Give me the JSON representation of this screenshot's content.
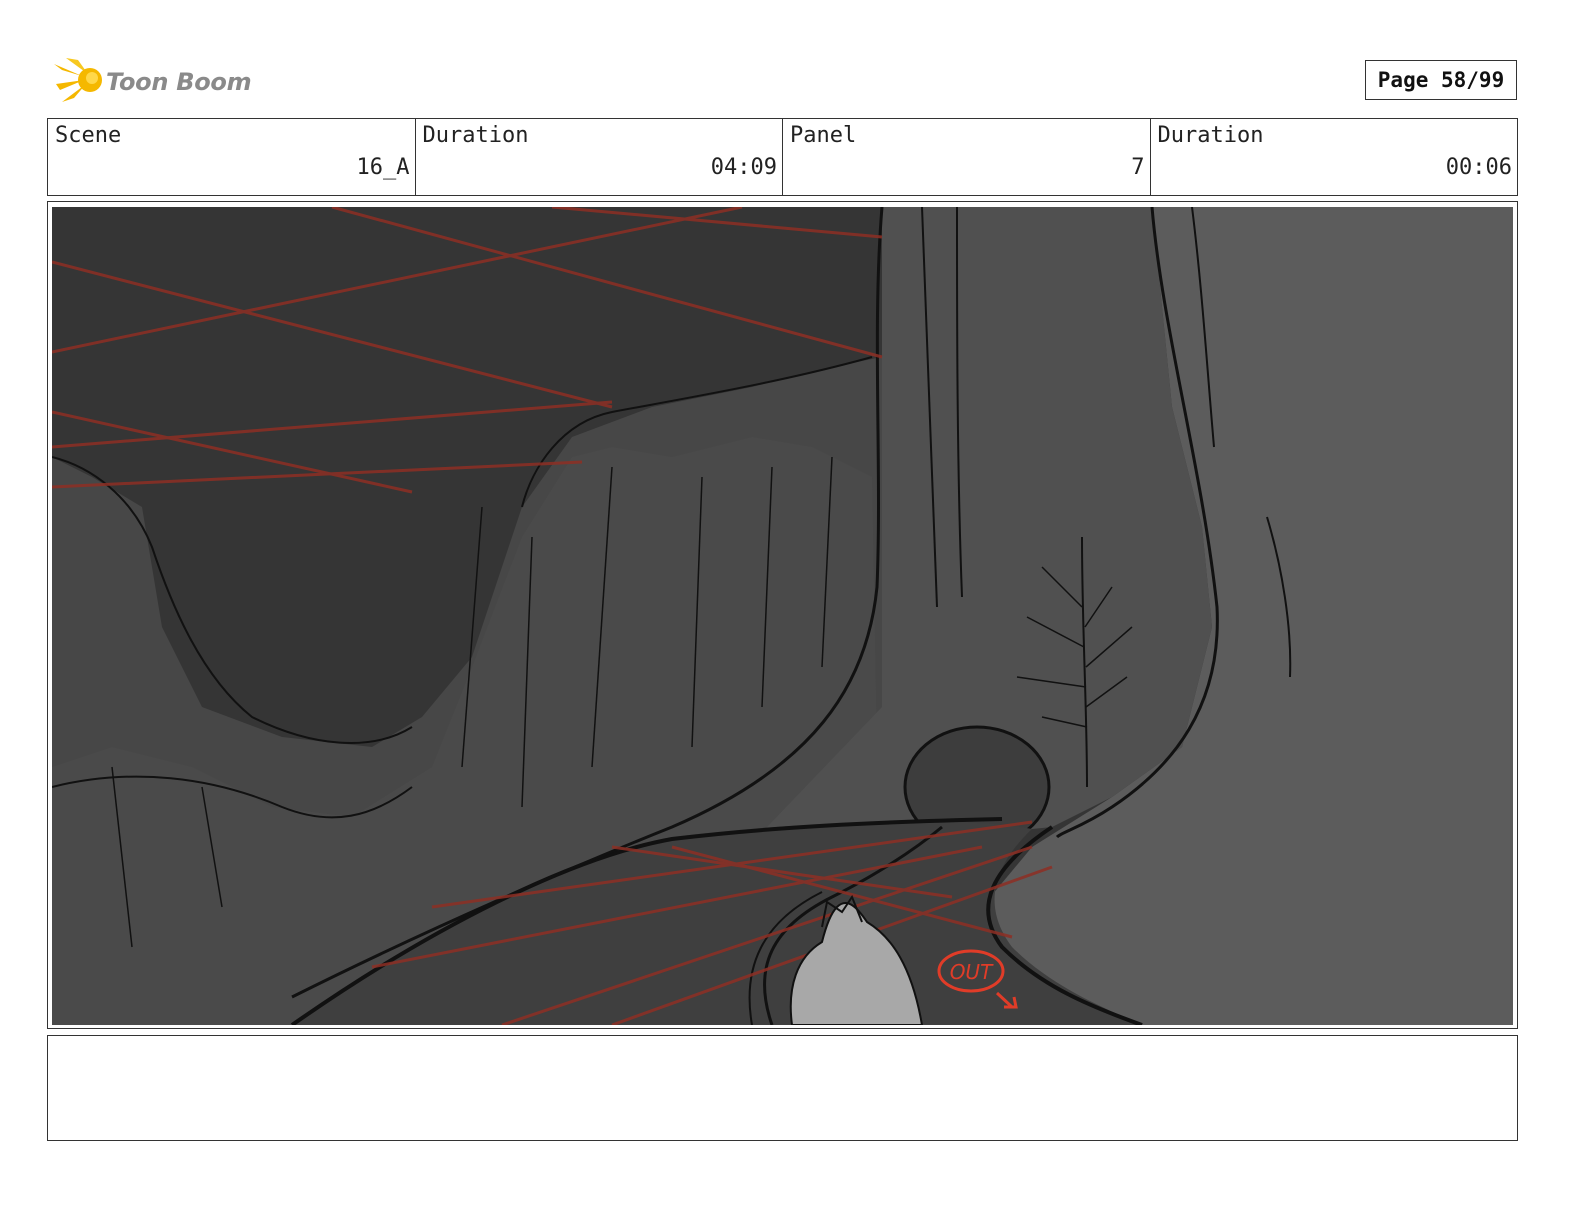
{
  "header": {
    "logo_text": "Toon Boom",
    "logo_icon": "toon-boom-star-icon",
    "page_label": "Page 58/99"
  },
  "info": {
    "scene_label": "Scene",
    "scene_value": "16_A",
    "scene_duration_label": "Duration",
    "scene_duration_value": "04:09",
    "panel_label": "Panel",
    "panel_value": "7",
    "panel_duration_label": "Duration",
    "panel_duration_value": "00:06"
  },
  "panel": {
    "annotation": "OUT",
    "annotation_color": "#e03c28",
    "guide_color": "#8e2f24"
  },
  "notes": {
    "text": ""
  }
}
